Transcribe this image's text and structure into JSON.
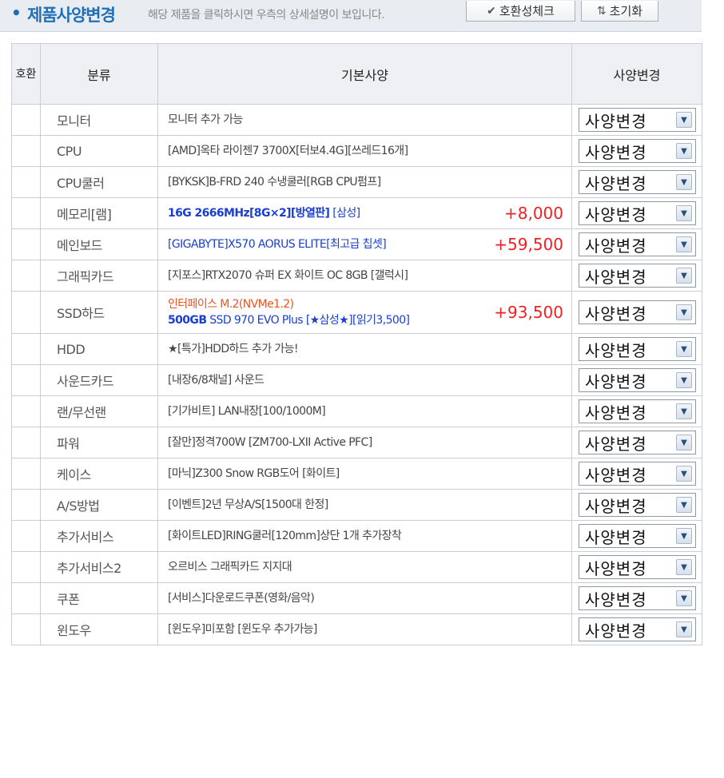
{
  "header": {
    "bullet": "•",
    "title": "제품사양변경",
    "hint": "해당 제품을 클릭하시면 우측의 상세설명이 보입니다.",
    "check_button": "호환성체크",
    "reset_button": "초기화"
  },
  "table": {
    "columns": [
      "호환",
      "분류",
      "기본사양",
      "사양변경"
    ],
    "rows": [
      {
        "category": "모니터",
        "spec": [
          {
            "text": "모니터 추가 가능"
          }
        ],
        "price": "",
        "option": "사양변경"
      },
      {
        "category": "CPU",
        "spec": [
          {
            "text": "[AMD]옥타 라이젠7 3700X[터보4.4G][쓰레드16개]"
          }
        ],
        "price": "",
        "option": "사양변경"
      },
      {
        "category": "CPU쿨러",
        "spec": [
          {
            "text": "[BYKSK]B-FRD 240 수냉쿨러[RGB CPU펌프]"
          }
        ],
        "price": "",
        "option": "사양변경"
      },
      {
        "category": "메모리[램]",
        "spec": [
          {
            "text": "16G 2666MHz[8G×2][방열판]",
            "style": "blue bold"
          },
          {
            "text": " [삼성]",
            "style": "blue"
          }
        ],
        "price": "+8,000",
        "option": "사양변경"
      },
      {
        "category": "메인보드",
        "spec": [
          {
            "text": "[GIGABYTE]X570 AORUS ELITE[최고급 칩셋]",
            "style": "blue"
          }
        ],
        "price": "+59,500",
        "option": "사양변경"
      },
      {
        "category": "그래픽카드",
        "spec": [
          {
            "text": "[지포스]RTX2070 슈퍼 EX 화이트 OC 8GB [갤럭시]"
          }
        ],
        "price": "",
        "option": "사양변경"
      },
      {
        "category": "SSD하드",
        "tall": true,
        "spec": [
          {
            "text": "인터페이스 M.2(NVMe1.2)",
            "style": "orange",
            "br": true
          },
          {
            "text": "500GB",
            "style": "blue bold"
          },
          {
            "text": " SSD 970 EVO Plus ",
            "style": "blue"
          },
          {
            "text": "[★삼성★][읽기3,500]",
            "style": "blue"
          }
        ],
        "price": "+93,500",
        "option": "사양변경"
      },
      {
        "category": "HDD",
        "spec": [
          {
            "text": "★[특가]HDD하드 추가 가능!"
          }
        ],
        "price": "",
        "option": "사양변경"
      },
      {
        "category": "사운드카드",
        "spec": [
          {
            "text": "[내장6/8채널] 사운드"
          }
        ],
        "price": "",
        "option": "사양변경"
      },
      {
        "category": "랜/무선랜",
        "spec": [
          {
            "text": "[기가비트] LAN내장[100/1000M]"
          }
        ],
        "price": "",
        "option": "사양변경"
      },
      {
        "category": "파워",
        "spec": [
          {
            "text": "[잘만]정격700W [ZM700-LXII Active PFC]"
          }
        ],
        "price": "",
        "option": "사양변경"
      },
      {
        "category": "케이스",
        "spec": [
          {
            "text": "[마닉]Z300 Snow RGB도어 [화이트]"
          }
        ],
        "price": "",
        "option": "사양변경"
      },
      {
        "category": "A/S방법",
        "spec": [
          {
            "text": "[이벤트]2년 무상A/S[1500대 한정]"
          }
        ],
        "price": "",
        "option": "사양변경"
      },
      {
        "category": "추가서비스",
        "spec": [
          {
            "text": "[화이트LED]RING쿨러[120mm]상단 1개 추가장착"
          }
        ],
        "price": "",
        "option": "사양변경"
      },
      {
        "category": "추가서비스2",
        "spec": [
          {
            "text": "오르비스 그래픽카드 지지대"
          }
        ],
        "price": "",
        "option": "사양변경"
      },
      {
        "category": "쿠폰",
        "spec": [
          {
            "text": "[서비스]다운로드쿠폰(영화/음악)"
          }
        ],
        "price": "",
        "option": "사양변경"
      },
      {
        "category": "윈도우",
        "spec": [
          {
            "text": "[윈도우]미포함 [윈도우 추가가능]"
          }
        ],
        "price": "",
        "option": "사양변경"
      }
    ]
  },
  "colors": {
    "title": "#1f6fb8",
    "price": "#ee2222",
    "highlight_blue": "#1a3fcf",
    "highlight_orange": "#e8531f"
  }
}
